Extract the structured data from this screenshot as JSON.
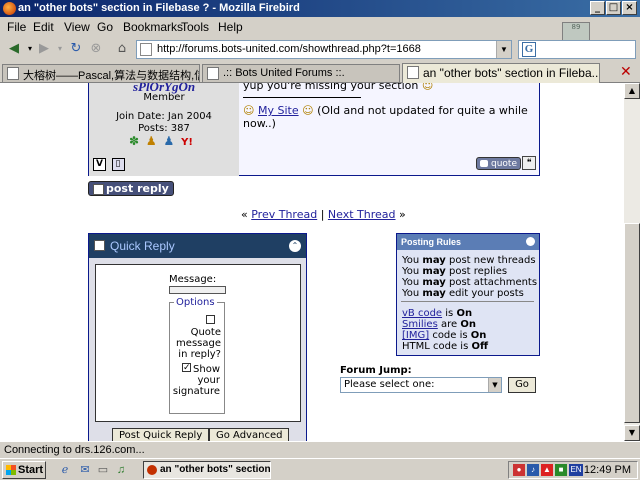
{
  "window": {
    "title": "an \"other bots\" section in Filebase ? - Mozilla Firebird",
    "minimize": "_",
    "maximize": "□",
    "close": "×"
  },
  "menu": {
    "file": "File",
    "edit": "Edit",
    "view": "View",
    "go": "Go",
    "bookmarks": "Bookmarks",
    "tools": "Tools",
    "help": "Help"
  },
  "throbber_text": "89",
  "nav": {
    "url": "http://forums.bots-united.com/showthread.php?t=1668",
    "search_glyph": "G"
  },
  "tabs": [
    {
      "label": "大榕树——Pascal,算法与数据结构,信息..."
    },
    {
      "label": ".:: Bots United Forums ::."
    },
    {
      "label": "an \"other bots\" section in Fileba..."
    }
  ],
  "tab_close": "✕",
  "post": {
    "username": "sPlOrYgOn",
    "rank": "Member",
    "join_date": "Join Date: Jan 2004",
    "posts": "Posts: 387",
    "message": "yup you're missing your section",
    "sig_link": "My Site",
    "sig_text": "(Old and not updated for quite a while now..)",
    "quote_label": "quote",
    "badge_y": "Y!",
    "profile_v": "V"
  },
  "post_reply_label": "post reply",
  "thread_nav": {
    "prev_arrows": "«",
    "prev": "Prev Thread",
    "sep": "|",
    "next": "Next Thread",
    "next_arrows": "»"
  },
  "quick_reply": {
    "title": "Quick Reply",
    "message_label": "Message:",
    "options_legend": "Options",
    "quote_option": "Quote message in reply?",
    "quote_checked": false,
    "sig_option": "Show your signature",
    "sig_checked": true,
    "submit": "Post Quick Reply",
    "advanced": "Go Advanced"
  },
  "posting_rules": {
    "title": "Posting Rules",
    "lines": [
      {
        "pre": "You ",
        "bold": "may",
        "post": " post new threads"
      },
      {
        "pre": "You ",
        "bold": "may",
        "post": " post replies"
      },
      {
        "pre": "You ",
        "bold": "may",
        "post": " post attachments"
      },
      {
        "pre": "You ",
        "bold": "may",
        "post": " edit your posts"
      }
    ],
    "vb_code": "vB code",
    "vb_is": " is ",
    "vb_state": "On",
    "smilies": "Smilies",
    "smilies_are": " are ",
    "smilies_state": "On",
    "img": "[IMG]",
    "img_is": " code is ",
    "img_state": "On",
    "html": "HTML code is ",
    "html_state": "Off"
  },
  "forum_jump": {
    "label": "Forum Jump:",
    "selected": "Please select one:",
    "go": "Go"
  },
  "status": "Connecting to drs.126.com...",
  "taskbar": {
    "start": "Start",
    "item": "an \"other bots\" section...",
    "clock": "12:49 PM",
    "lang": "EN"
  },
  "colors": {
    "titlebar": "#0a246a",
    "link": "#22229c",
    "forum_border": "#0b198c",
    "quick_reply_header": "#1f3f63"
  }
}
